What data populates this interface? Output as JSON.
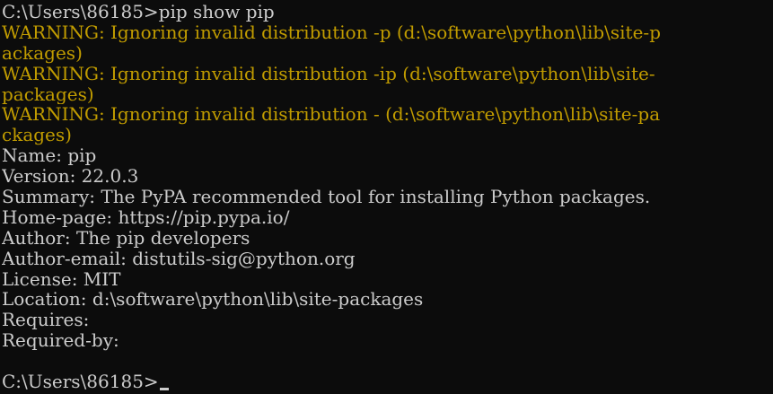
{
  "terminal": {
    "colors": {
      "background": "#0c0c0c",
      "text": "#cccccc",
      "warning": "#c19c00"
    },
    "lines": [
      {
        "text": "C:\\Users\\86185>pip show pip",
        "kind": "out"
      },
      {
        "text": "WARNING: Ignoring invalid distribution -p (d:\\software\\python\\lib\\site-p",
        "kind": "warn"
      },
      {
        "text": "ackages)",
        "kind": "warn"
      },
      {
        "text": "WARNING: Ignoring invalid distribution -ip (d:\\software\\python\\lib\\site-",
        "kind": "warn"
      },
      {
        "text": "packages)",
        "kind": "warn"
      },
      {
        "text": "WARNING: Ignoring invalid distribution - (d:\\software\\python\\lib\\site-pa",
        "kind": "warn"
      },
      {
        "text": "ckages)",
        "kind": "warn"
      },
      {
        "text": "Name: pip",
        "kind": "out"
      },
      {
        "text": "Version: 22.0.3",
        "kind": "out"
      },
      {
        "text": "Summary: The PyPA recommended tool for installing Python packages.",
        "kind": "out"
      },
      {
        "text": "Home-page: https://pip.pypa.io/",
        "kind": "out"
      },
      {
        "text": "Author: The pip developers",
        "kind": "out"
      },
      {
        "text": "Author-email: distutils-sig@python.org",
        "kind": "out"
      },
      {
        "text": "License: MIT",
        "kind": "out"
      },
      {
        "text": "Location: d:\\software\\python\\lib\\site-packages",
        "kind": "out"
      },
      {
        "text": "Requires:",
        "kind": "out"
      },
      {
        "text": "Required-by:",
        "kind": "out"
      },
      {
        "text": "",
        "kind": "out"
      }
    ],
    "prompt": "C:\\Users\\86185>"
  }
}
